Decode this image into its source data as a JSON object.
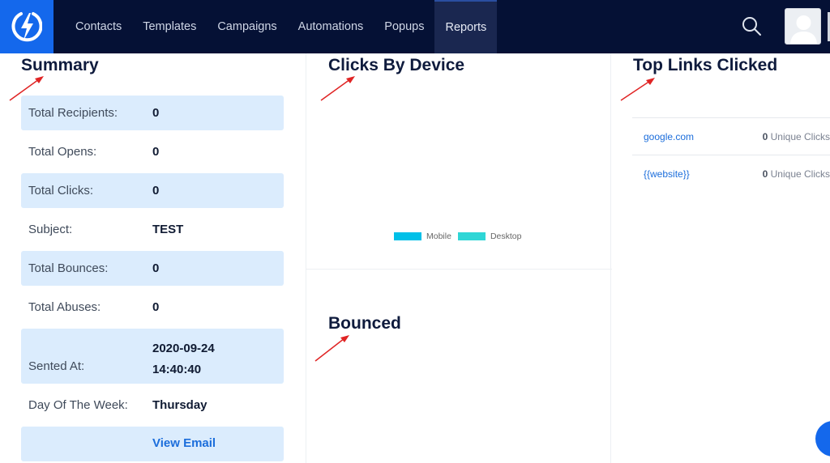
{
  "nav": {
    "items": [
      {
        "label": "Contacts"
      },
      {
        "label": "Templates"
      },
      {
        "label": "Campaigns"
      },
      {
        "label": "Automations"
      },
      {
        "label": "Popups"
      },
      {
        "label": "Reports",
        "active": true
      }
    ],
    "logo_icon": "lightning-bolt-icon",
    "search_icon": "search-icon",
    "avatar_icon": "user-avatar-icon"
  },
  "summary": {
    "title": "Summary",
    "rows": [
      {
        "label": "Total Recipients:",
        "value": "0"
      },
      {
        "label": "Total Opens:",
        "value": "0"
      },
      {
        "label": "Total Clicks:",
        "value": "0"
      },
      {
        "label": "Subject:",
        "value": "TEST"
      },
      {
        "label": "Total Bounces:",
        "value": "0"
      },
      {
        "label": "Total Abuses:",
        "value": "0"
      },
      {
        "label": "Sented At:",
        "value_line1": "2020-09-24",
        "value_line2": "14:40:40"
      },
      {
        "label": "Day Of The Week:",
        "value": "Thursday"
      }
    ],
    "view_email": "View Email"
  },
  "clicks_by_device": {
    "title": "Clicks By Device",
    "legend": [
      {
        "label": "Mobile",
        "color": "#00c0e8"
      },
      {
        "label": "Desktop",
        "color": "#2fd6d6"
      }
    ]
  },
  "bounced": {
    "title": "Bounced"
  },
  "top_links": {
    "title": "Top Links Clicked",
    "links": [
      {
        "url": "google.com",
        "count": "0",
        "suffix": "Unique Clicks"
      },
      {
        "url": "{{website}}",
        "count": "0",
        "suffix": "Unique Clicks"
      }
    ]
  },
  "colors": {
    "navbar": "#051135",
    "brand": "#1468ec",
    "row_shade": "#dbecfd",
    "link": "#1b6ddb",
    "annotation_arrow": "#e02424"
  }
}
